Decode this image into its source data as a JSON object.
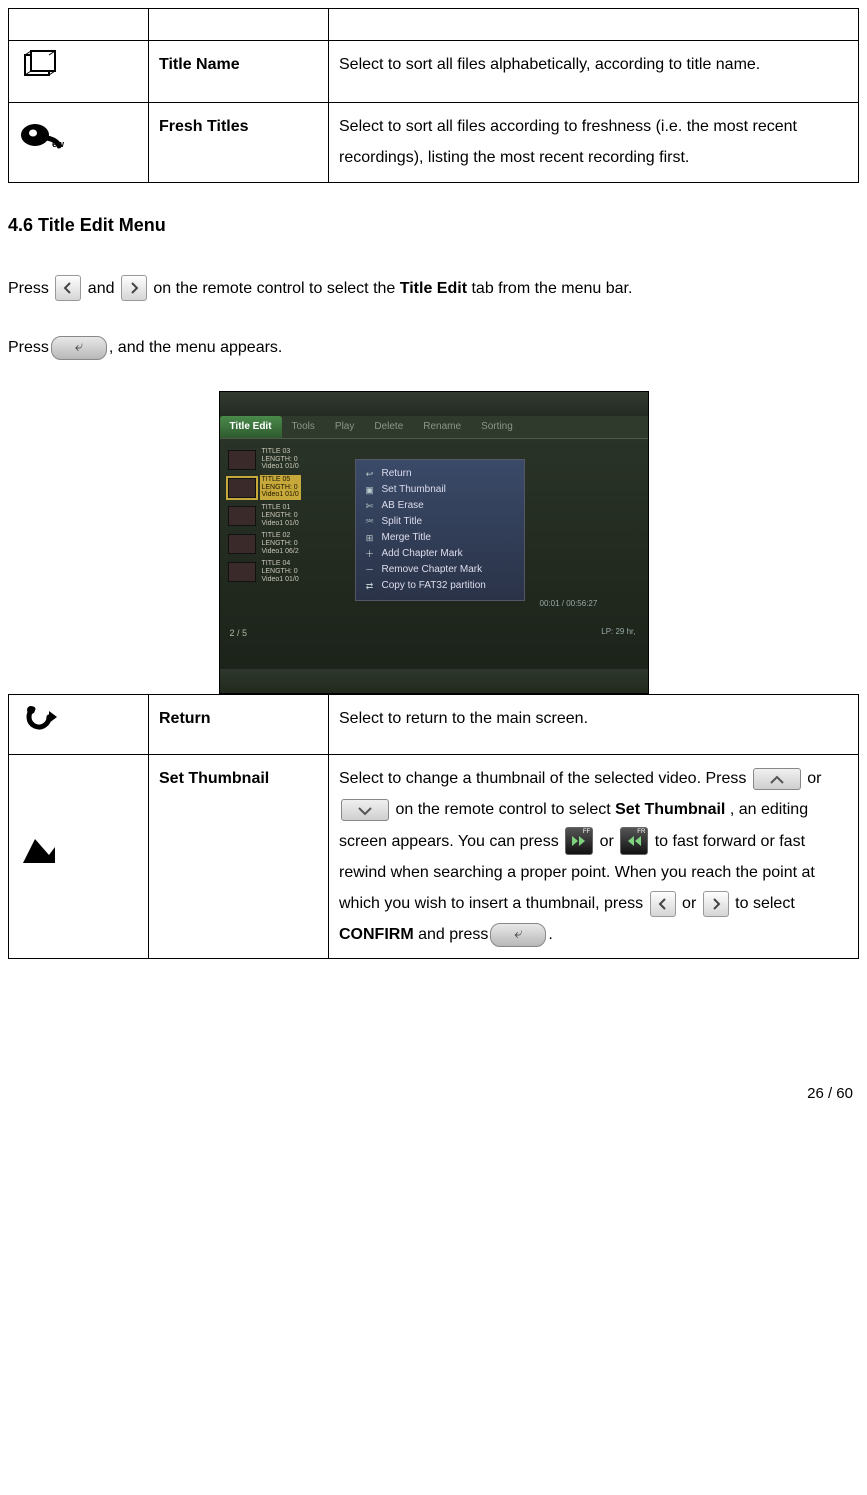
{
  "table1": {
    "rows": [
      {
        "label": "Title Name",
        "desc": "Select to sort all files alphabetically, according to title name."
      },
      {
        "label": "Fresh Titles",
        "desc": "Select to sort all files according to freshness (i.e. the most recent recordings), listing the most recent recording first."
      }
    ]
  },
  "section_title": "4.6 Title Edit Menu",
  "para1": {
    "t1": "Press ",
    "t2": " and ",
    "t3": " on the remote control to select the ",
    "bold": "Title Edit",
    "t4": " tab from the menu bar."
  },
  "para2": {
    "t1": "Press",
    "t2": ", and the menu appears."
  },
  "screenshot": {
    "tabs": [
      "Title Edit",
      "Tools",
      "Play",
      "Delete",
      "Rename",
      "Sorting"
    ],
    "list": [
      {
        "title": "TITLE 03",
        "len": "LENGTH: 0",
        "src": "Video1 01/0"
      },
      {
        "title": "TITLE 05",
        "len": "LENGTH: 0",
        "src": "Video1 01/0"
      },
      {
        "title": "TITLE 01",
        "len": "LENGTH: 0",
        "src": "Video1 01/0"
      },
      {
        "title": "TITLE 02",
        "len": "LENGTH: 0",
        "src": "Video1 06/2"
      },
      {
        "title": "TITLE 04",
        "len": "LENGTH: 0",
        "src": "Video1 01/0"
      }
    ],
    "menu": [
      "Return",
      "Set Thumbnail",
      "AB Erase",
      "Split Title",
      "Merge Title",
      "Add Chapter Mark",
      "Remove Chapter Mark",
      "Copy to FAT32 partition"
    ],
    "time": "00:01 / 00:56:27",
    "lp": "LP: 29 hr,",
    "count": "2 / 5"
  },
  "table2": {
    "rows": [
      {
        "label": "Return",
        "desc_plain": "Select to return to the main screen."
      },
      {
        "label": "Set Thumbnail",
        "parts": {
          "a": "Select to change a thumbnail of the selected video. Press ",
          "b": " or ",
          "c": " on the remote control to select ",
          "bold1": "Set Thumbnail",
          "d": ", an editing screen appears. You can press ",
          "e": " or ",
          "f": " to fast forward or fast rewind when searching a proper point. When you reach the point at which you wish to insert a thumbnail, press ",
          "g": " or ",
          "h": " to select ",
          "bold2": "CONFIRM",
          "i": " and press",
          "j": "."
        }
      }
    ]
  },
  "page_footer": "26 / 60"
}
